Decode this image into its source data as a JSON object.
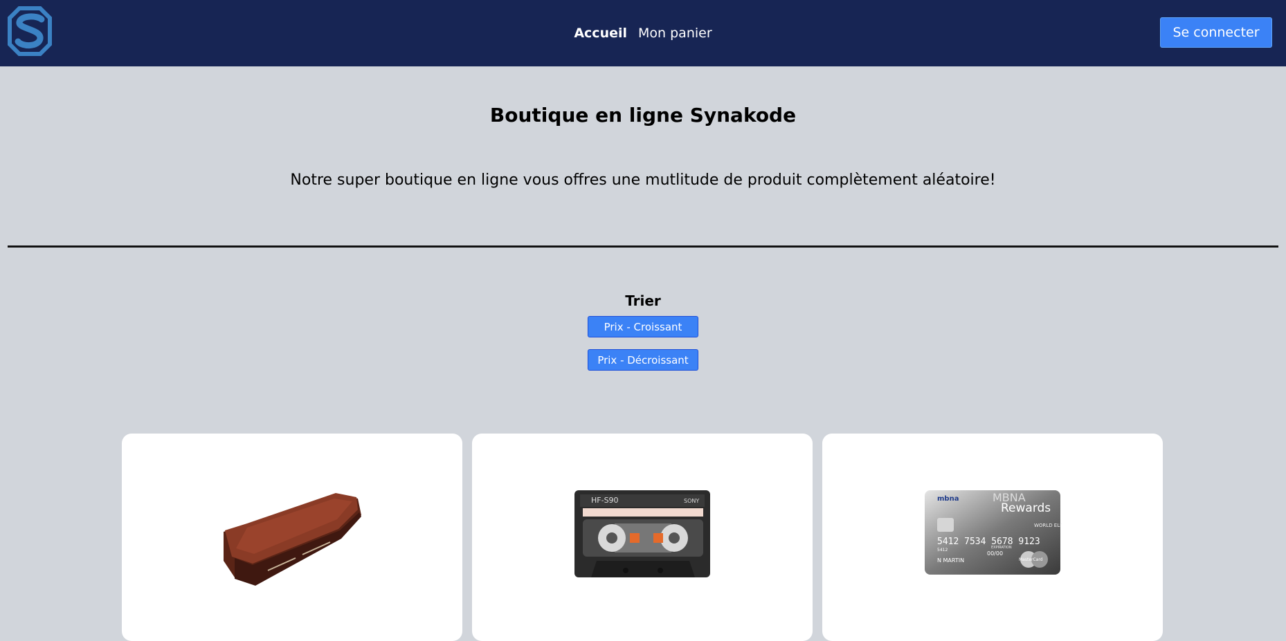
{
  "navbar": {
    "links": [
      {
        "label": "Accueil",
        "active": true
      },
      {
        "label": "Mon panier",
        "active": false
      }
    ],
    "login_label": "Se connecter",
    "colors": {
      "background": "#172554",
      "accent": "#3b82f6"
    }
  },
  "hero": {
    "title": "Boutique en ligne Synakode",
    "text": "Notre super boutique en ligne vous offres une mutlitude de produit complètement aléatoire!"
  },
  "sort": {
    "title": "Trier",
    "asc_label": "Prix - Croissant",
    "desc_label": "Prix - Décroissant"
  },
  "products": [
    {
      "icon": "coffin-icon"
    },
    {
      "icon": "cassette-tape-icon"
    },
    {
      "icon": "credit-card-icon",
      "card_text": {
        "bank": "mbna",
        "brand": "MBNA",
        "program": "Rewards",
        "tier": "WORLD ELITE",
        "number": "5412 7534 5678 9123",
        "prefix": "5412",
        "expiry_label": "EXPIRATION",
        "expiry": "00/00",
        "holder": "N MARTIN",
        "network": "MasterCard"
      }
    }
  ]
}
